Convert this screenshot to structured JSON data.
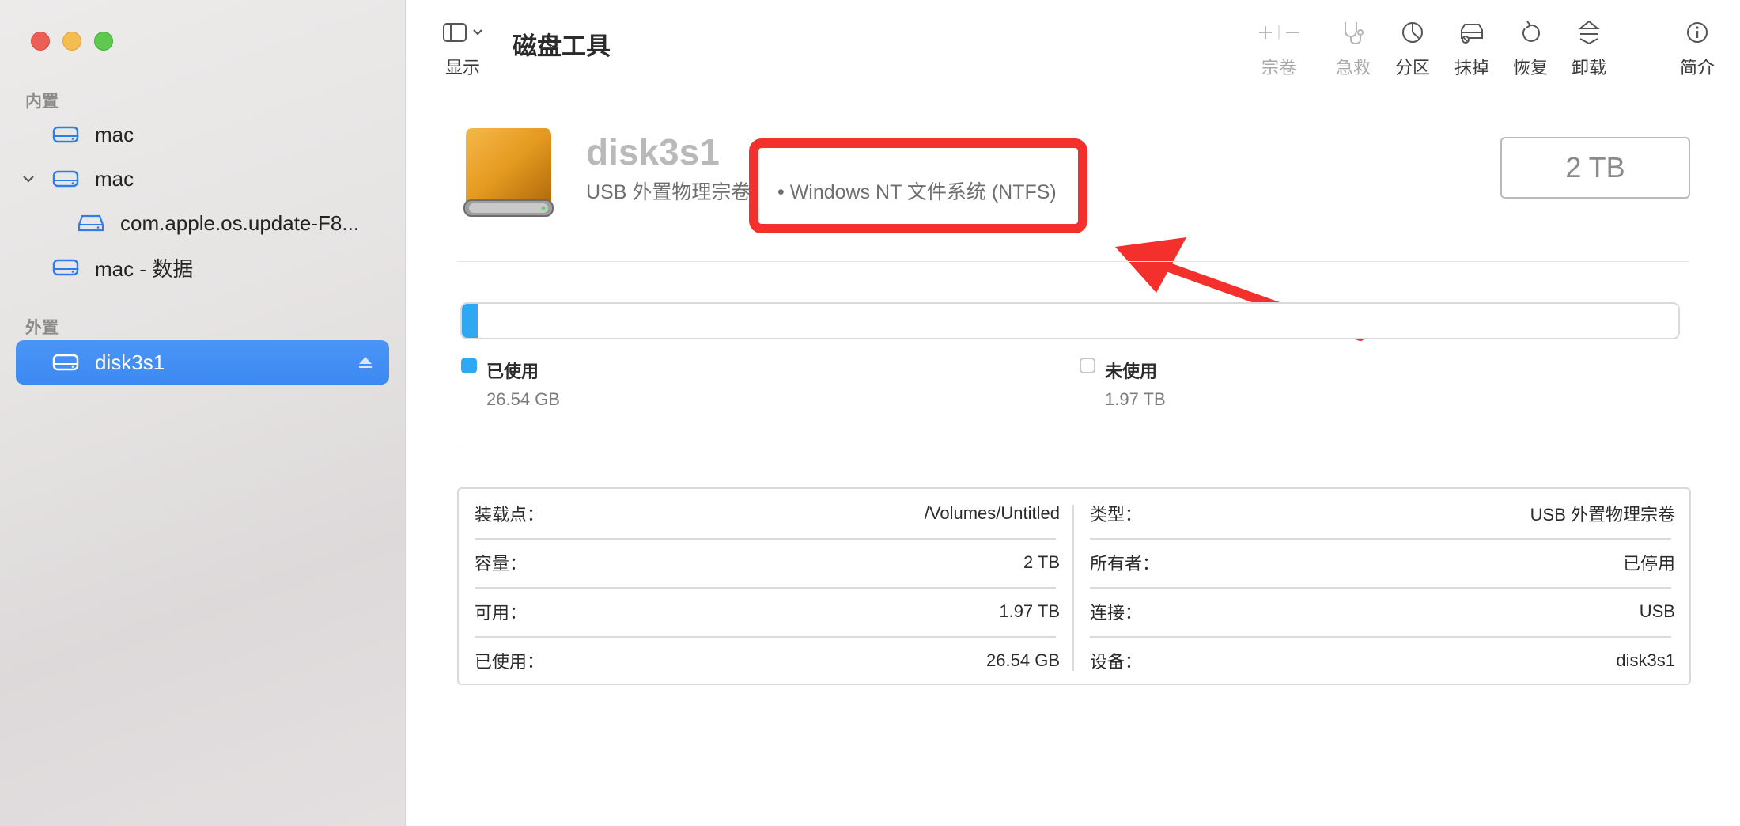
{
  "app_title": "磁盘工具",
  "toolbar": {
    "view_label": "显示",
    "buttons": [
      {
        "name": "volume",
        "label": "宗卷",
        "icon": "plus-minus-icon",
        "disabled": true
      },
      {
        "name": "firstaid",
        "label": "急救",
        "icon": "stethoscope-icon",
        "disabled": true
      },
      {
        "name": "partition",
        "label": "分区",
        "icon": "pie-chart-icon",
        "disabled": false
      },
      {
        "name": "erase",
        "label": "抹掉",
        "icon": "erase-drive-icon",
        "disabled": false
      },
      {
        "name": "restore",
        "label": "恢复",
        "icon": "restore-icon",
        "disabled": false
      },
      {
        "name": "unmount",
        "label": "卸载",
        "icon": "unmount-icon",
        "disabled": false
      },
      {
        "name": "info",
        "label": "简介",
        "icon": "info-icon",
        "disabled": false
      }
    ]
  },
  "sidebar": {
    "internal_label": "内置",
    "external_label": "外置",
    "items": [
      {
        "label": "mac"
      },
      {
        "label": "mac"
      },
      {
        "label": "com.apple.os.update-F8..."
      },
      {
        "label": "mac - 数据"
      },
      {
        "label": "disk3s1"
      }
    ]
  },
  "disk": {
    "name": "disk3s1",
    "subtitle_prefix": "USB 外置物理宗卷",
    "subtitle_highlight": "• Windows NT 文件系统 (NTFS)",
    "size": "2 TB"
  },
  "usage": {
    "used_fraction": 0.013,
    "used_label": "已使用",
    "used_value": "26.54 GB",
    "free_label": "未使用",
    "free_value": "1.97 TB",
    "used_color": "#2fa8f2"
  },
  "info": {
    "left": [
      {
        "key": "装载点：",
        "value": "/Volumes/Untitled"
      },
      {
        "key": "容量：",
        "value": "2 TB"
      },
      {
        "key": "可用：",
        "value": "1.97 TB"
      },
      {
        "key": "已使用：",
        "value": "26.54 GB"
      }
    ],
    "right": [
      {
        "key": "类型：",
        "value": "USB 外置物理宗卷"
      },
      {
        "key": "所有者：",
        "value": "已停用"
      },
      {
        "key": "连接：",
        "value": "USB"
      },
      {
        "key": "设备：",
        "value": "disk3s1"
      }
    ]
  },
  "colors": {
    "accent": "#3b89f2",
    "annotation_red": "#f3302b"
  }
}
